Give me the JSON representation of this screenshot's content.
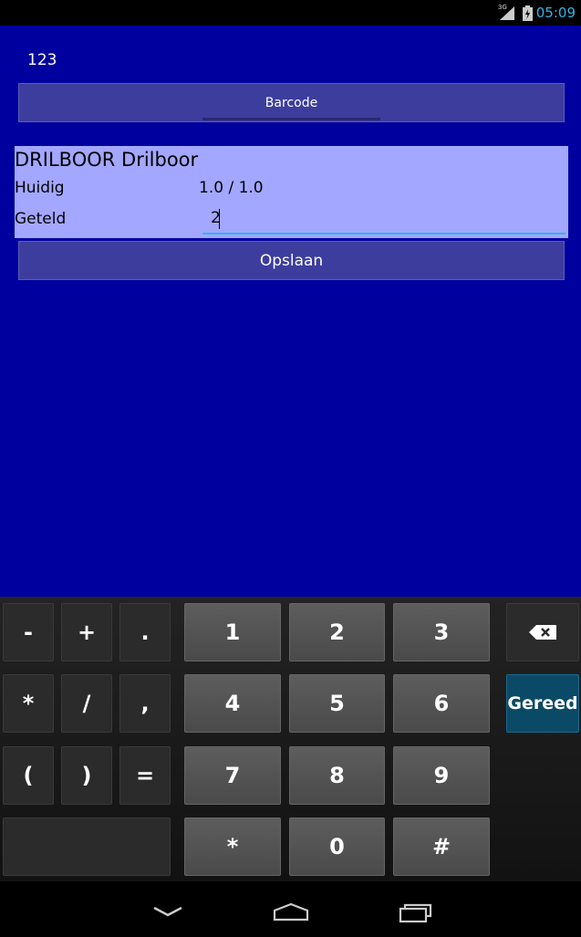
{
  "status_bar": {
    "time": "05:09",
    "network": "3G",
    "signal_icon": "signal-icon",
    "battery_icon": "battery-charging-icon"
  },
  "app": {
    "code_value": "123",
    "barcode_button_label": "Barcode",
    "item": {
      "title": "DRILBOOR Drilboor",
      "huidig_label": "Huidig",
      "huidig_value": "1.0 / 1.0",
      "geteld_label": "Geteld",
      "geteld_value": "2"
    },
    "save_button_label": "Opslaan",
    "colors": {
      "background": "#00009e",
      "panel": "#a3a7ff",
      "button": "#3d3d9e",
      "accent": "#33b5e5"
    }
  },
  "keyboard": {
    "small_keys": [
      "-",
      "+",
      ".",
      "*",
      "/",
      ",",
      "(",
      ")",
      "="
    ],
    "num_keys": [
      "1",
      "2",
      "3",
      "4",
      "5",
      "6",
      "7",
      "8",
      "9",
      "*",
      "0",
      "#"
    ],
    "done_label": "Gereed",
    "backspace_icon": "backspace-icon"
  },
  "navbar": {
    "back_icon": "back-icon",
    "home_icon": "home-icon",
    "recents_icon": "recents-icon"
  }
}
